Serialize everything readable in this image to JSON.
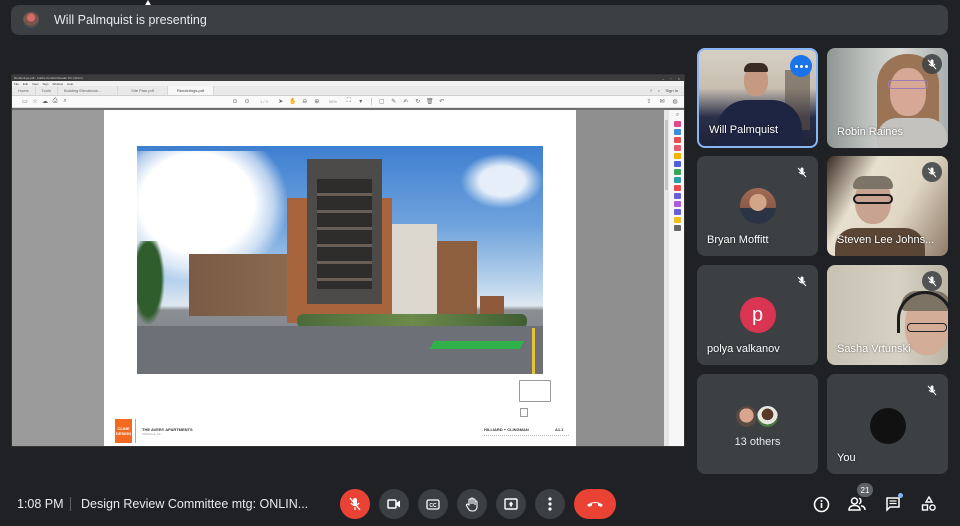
{
  "banner": {
    "presenter_text": "Will Palmquist is presenting",
    "avatar_icon": "presenter-avatar"
  },
  "shared_screen": {
    "window_title": "Renderings.pdf - Adobe Acrobat Reader DC (32-bit)",
    "menu": [
      "File",
      "Edit",
      "View",
      "Sign",
      "Window",
      "Help"
    ],
    "nav_tabs": [
      "Home",
      "Tools"
    ],
    "doc_tabs": [
      {
        "label": "Building Elevations...",
        "active": false
      },
      {
        "label": "Site Plan.pdf",
        "active": false
      },
      {
        "label": "Renderings.pdf",
        "active": true
      }
    ],
    "sign_in": "Sign In",
    "page_indicator": "1 / 3",
    "zoom_value": "50%",
    "document": {
      "project_title": "THE AVERY APARTMENTS",
      "project_location": "ASHEVILLE, NC",
      "logo_line1": "CLINE",
      "logo_line2": "DESIGN",
      "sheet_title": "HILLIARD + CLINGMAN",
      "sheet_number": "A1.1",
      "rendering_description": "Street-level rendering of multi-story brick apartment building at an intersection with bike lane"
    },
    "right_rail_colors": [
      "#e04a8c",
      "#3f8fd8",
      "#e85050",
      "#e85a6e",
      "#f2b400",
      "#4b5fd8",
      "#3aa55a",
      "#2ba0a8",
      "#e84b4b",
      "#6b5fd8",
      "#b35ad8",
      "#6b5fd8",
      "#f0c020",
      "#666666"
    ]
  },
  "participants": [
    {
      "name": "Will Palmquist",
      "muted": false,
      "active_speaker": true,
      "type": "video",
      "has_more_button": true
    },
    {
      "name": "Robin Raines",
      "muted": true,
      "type": "video"
    },
    {
      "name": "Bryan Moffitt",
      "muted": true,
      "type": "photo"
    },
    {
      "name": "Steven Lee Johns...",
      "muted": true,
      "type": "video"
    },
    {
      "name": "polya valkanov",
      "muted": true,
      "type": "initial",
      "initial": "p",
      "avatar_color": "#d93553"
    },
    {
      "name": "Sasha Vrtunski",
      "muted": true,
      "type": "video"
    },
    {
      "name": "13 others",
      "type": "group"
    },
    {
      "name": "You",
      "muted": true,
      "type": "self"
    }
  ],
  "bottom_bar": {
    "time": "1:08 PM",
    "meeting_title": "Design Review Committee mtg: ONLIN...",
    "controls": [
      {
        "name": "microphone-off",
        "state": "off"
      },
      {
        "name": "camera"
      },
      {
        "name": "captions",
        "glyph": "CC"
      },
      {
        "name": "raise-hand"
      },
      {
        "name": "present-now"
      },
      {
        "name": "more-options"
      },
      {
        "name": "leave-call"
      }
    ],
    "right": {
      "participants_count": "21",
      "chat_has_unread": true
    }
  },
  "colors": {
    "background": "#202124",
    "tile": "#3c4043",
    "accent_red": "#ea4335",
    "accent_blue": "#1a73e8",
    "active_border": "#8ab4f8"
  }
}
